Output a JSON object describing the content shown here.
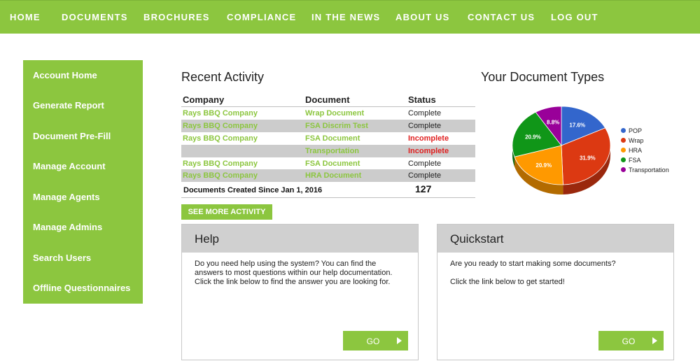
{
  "topnav": {
    "items": [
      {
        "label": "HOME"
      },
      {
        "label": "DOCUMENTS"
      },
      {
        "label": "BROCHURES"
      },
      {
        "label": "COMPLIANCE"
      },
      {
        "label": "IN THE NEWS"
      },
      {
        "label": "ABOUT US"
      },
      {
        "label": "CONTACT US"
      },
      {
        "label": "LOG OUT"
      }
    ]
  },
  "sidebar": {
    "items": [
      {
        "label": "Account Home"
      },
      {
        "label": "Generate Report"
      },
      {
        "label": "Document Pre-Fill"
      },
      {
        "label": "Manage Account"
      },
      {
        "label": "Manage Agents"
      },
      {
        "label": "Manage Admins"
      },
      {
        "label": "Search Users"
      },
      {
        "label": "Offline Questionnaires"
      }
    ]
  },
  "activity": {
    "title": "Recent Activity",
    "columns": [
      "Company",
      "Document",
      "Status"
    ],
    "rows": [
      {
        "company": "Rays BBQ Company",
        "document": "Wrap Document",
        "status": "Complete",
        "complete": true
      },
      {
        "company": "Rays BBQ Company",
        "document": "FSA Discrim Test",
        "status": "Complete",
        "complete": true
      },
      {
        "company": "Rays BBQ Company",
        "document": "FSA Document",
        "status": "Incomplete",
        "complete": false
      },
      {
        "company": "",
        "document": "Transportation",
        "status": "Incomplete",
        "complete": false
      },
      {
        "company": "Rays BBQ Company",
        "document": "FSA Document",
        "status": "Complete",
        "complete": true
      },
      {
        "company": "Rays BBQ Company",
        "document": "HRA Document",
        "status": "Complete",
        "complete": true
      }
    ],
    "total_label": "Documents Created Since Jan 1, 2016",
    "total_value": "127",
    "see_more_label": "SEE MORE ACTIVITY"
  },
  "doc_types": {
    "title": "Your Document Types"
  },
  "chart_data": {
    "type": "pie",
    "title": "",
    "categories": [
      "POP",
      "Wrap",
      "HRA",
      "FSA",
      "Transportation"
    ],
    "values": [
      17.6,
      31.9,
      20.9,
      20.9,
      8.8
    ],
    "labels": [
      "17.6%",
      "31.9%",
      "20.9%",
      "20.9%",
      "8.8%"
    ],
    "colors": [
      "#3366cc",
      "#dc3912",
      "#ff9900",
      "#109618",
      "#990099"
    ],
    "legend_position": "right"
  },
  "help_card": {
    "title": "Help",
    "body": "Do you need help using the system? You can find the answers to most questions within our help documentation. Click the link below to find the answer you are looking for.",
    "button_label": "GO"
  },
  "quickstart_card": {
    "title": "Quickstart",
    "line1": "Are you ready to start making some documents?",
    "line2": "Click the link below to get started!",
    "button_label": "GO"
  }
}
